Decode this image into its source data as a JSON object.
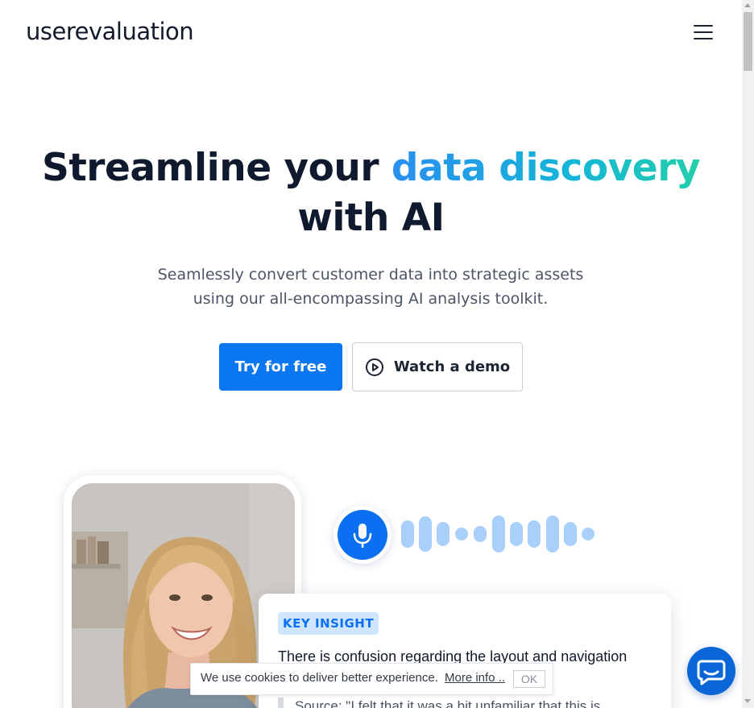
{
  "header": {
    "logo_text": "userevaluation",
    "menu_icon": "hamburger-menu-icon"
  },
  "hero": {
    "title_prefix": "Streamline your ",
    "title_highlight": "data discovery",
    "title_suffix": " with AI",
    "subtitle": "Seamlessly convert customer data into strategic assets using our all-encompassing AI analysis toolkit.",
    "primary_button": "Try for free",
    "secondary_button": "Watch a demo",
    "secondary_button_icon": "play-circle-icon",
    "gradient_colors": [
      "#2a8ff0",
      "#15b6d6",
      "#24cfa9"
    ]
  },
  "showcase": {
    "mic_icon": "microphone-icon",
    "waveform_icon": "audio-waveform-icon",
    "insight": {
      "badge": "KEY INSIGHT",
      "title": "There is confusion regarding the layout and navigation",
      "quote": "Source: \"I felt that it was a bit unfamiliar that this is"
    }
  },
  "cookie_bar": {
    "text": "We use cookies to deliver better experience.",
    "more_info": "More info ..",
    "ok": "OK"
  },
  "chat": {
    "icon": "chat-bubble-icon"
  },
  "colors": {
    "primary": "#0a76f0",
    "heading": "#101a2e",
    "body_text": "#4b5565",
    "chat": "#0a66d6"
  }
}
